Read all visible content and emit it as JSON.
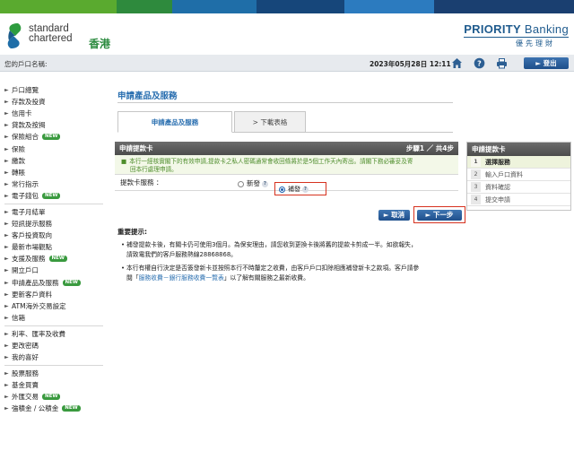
{
  "brand": {
    "name_line1": "standard",
    "name_line2": "chartered",
    "region": "香港",
    "priority_bold": "PRIORITY",
    "priority_rest": " Banking",
    "priority_chinese": "優先理財",
    "stripe_colors": [
      "#5aaa2f",
      "#2e8a3d",
      "#1f6ea8",
      "#16467a",
      "#2c7bbf",
      "#1a3f70"
    ],
    "blue": "#1f5b8e"
  },
  "infobar": {
    "account_label": "您的戶口名稱:",
    "datetime": "2023年05月28日 12:11",
    "icons": [
      "home-icon",
      "help-icon",
      "print-icon"
    ],
    "logout_label": "► 登出"
  },
  "sidebar": {
    "new_badge": "NEW",
    "groups": [
      [
        {
          "label": "戶口總覽",
          "new": false
        },
        {
          "label": "存款及投資",
          "new": false
        },
        {
          "label": "信用卡",
          "new": false
        },
        {
          "label": "貸款及按揭",
          "new": false
        },
        {
          "label": "保險組合",
          "new": true
        },
        {
          "label": "保險",
          "new": false
        },
        {
          "label": "繳款",
          "new": false
        },
        {
          "label": "轉賬",
          "new": false
        },
        {
          "label": "常行指示",
          "new": false
        },
        {
          "label": "電子錢包",
          "new": true
        }
      ],
      [
        {
          "label": "電子月結單",
          "new": false
        },
        {
          "label": "短訊提示服務",
          "new": false
        },
        {
          "label": "客戶投資取向",
          "new": false
        },
        {
          "label": "最新市場觀點",
          "new": false
        },
        {
          "label": "支援及服務",
          "new": true
        },
        {
          "label": "開立戶口",
          "new": false
        },
        {
          "label": "申請產品及服務",
          "new": true
        },
        {
          "label": "更新客戶資料",
          "new": false
        },
        {
          "label": "ATM海外交易設定",
          "new": false
        },
        {
          "label": "信箱",
          "new": false
        }
      ],
      [
        {
          "label": "利率、匯率及收費",
          "new": false
        },
        {
          "label": "更改密碼",
          "new": false
        },
        {
          "label": "我的喜好",
          "new": false
        }
      ],
      [
        {
          "label": "股票服務",
          "new": false
        },
        {
          "label": "基金買賣",
          "new": false
        },
        {
          "label": "外匯交易",
          "new": true
        },
        {
          "label": "強積金 / 公積金",
          "new": true
        }
      ]
    ]
  },
  "main": {
    "title": "申請產品及服務",
    "tabs": [
      {
        "label": "申請產品及服務"
      },
      {
        "label": "> 下載表格"
      }
    ],
    "panel": {
      "title": "申請提款卡",
      "step": "步驟1 ／ 共4步",
      "notice_line1": "本行一經核實閣下的有效申請,提款卡之私人密碼通常會收回條將於是5個工作天內寄出。請閣下務必審妥及寄",
      "notice_line2": "回本行處理申請。",
      "field_label": "提款卡服務 ：",
      "option_new": "新發",
      "option_replace": "補發",
      "help_glyph": "?"
    },
    "buttons": {
      "cancel": "► 取消",
      "next": "► 下一步"
    },
    "notes": {
      "heading": "重要提示:",
      "items": [
        {
          "line1": "補發提款卡後，有關卡仍可使用3個月。為保安理由，請您收到更換卡後將舊的提款卡剪成一半。如欲報失，",
          "line2": "請致電我們的客戶服務熱線28868868。"
        },
        {
          "line1": "本行有權自行決定是否簽發新卡並按照本行不時釐定之收費，由客戶戶口扣除相應補發新卡之款項。客戶請參",
          "line2_pre": "閱「",
          "line2_link": "服務收費－銀行服務收費一覽表",
          "line2_post": "」以了解有關服務之最新收費。"
        }
      ]
    }
  },
  "steps": {
    "title": "申請提款卡",
    "items": [
      {
        "n": "1",
        "label": "選擇服務"
      },
      {
        "n": "2",
        "label": "輸入戶口資料"
      },
      {
        "n": "3",
        "label": "資料確認"
      },
      {
        "n": "4",
        "label": "提交申請"
      }
    ]
  }
}
